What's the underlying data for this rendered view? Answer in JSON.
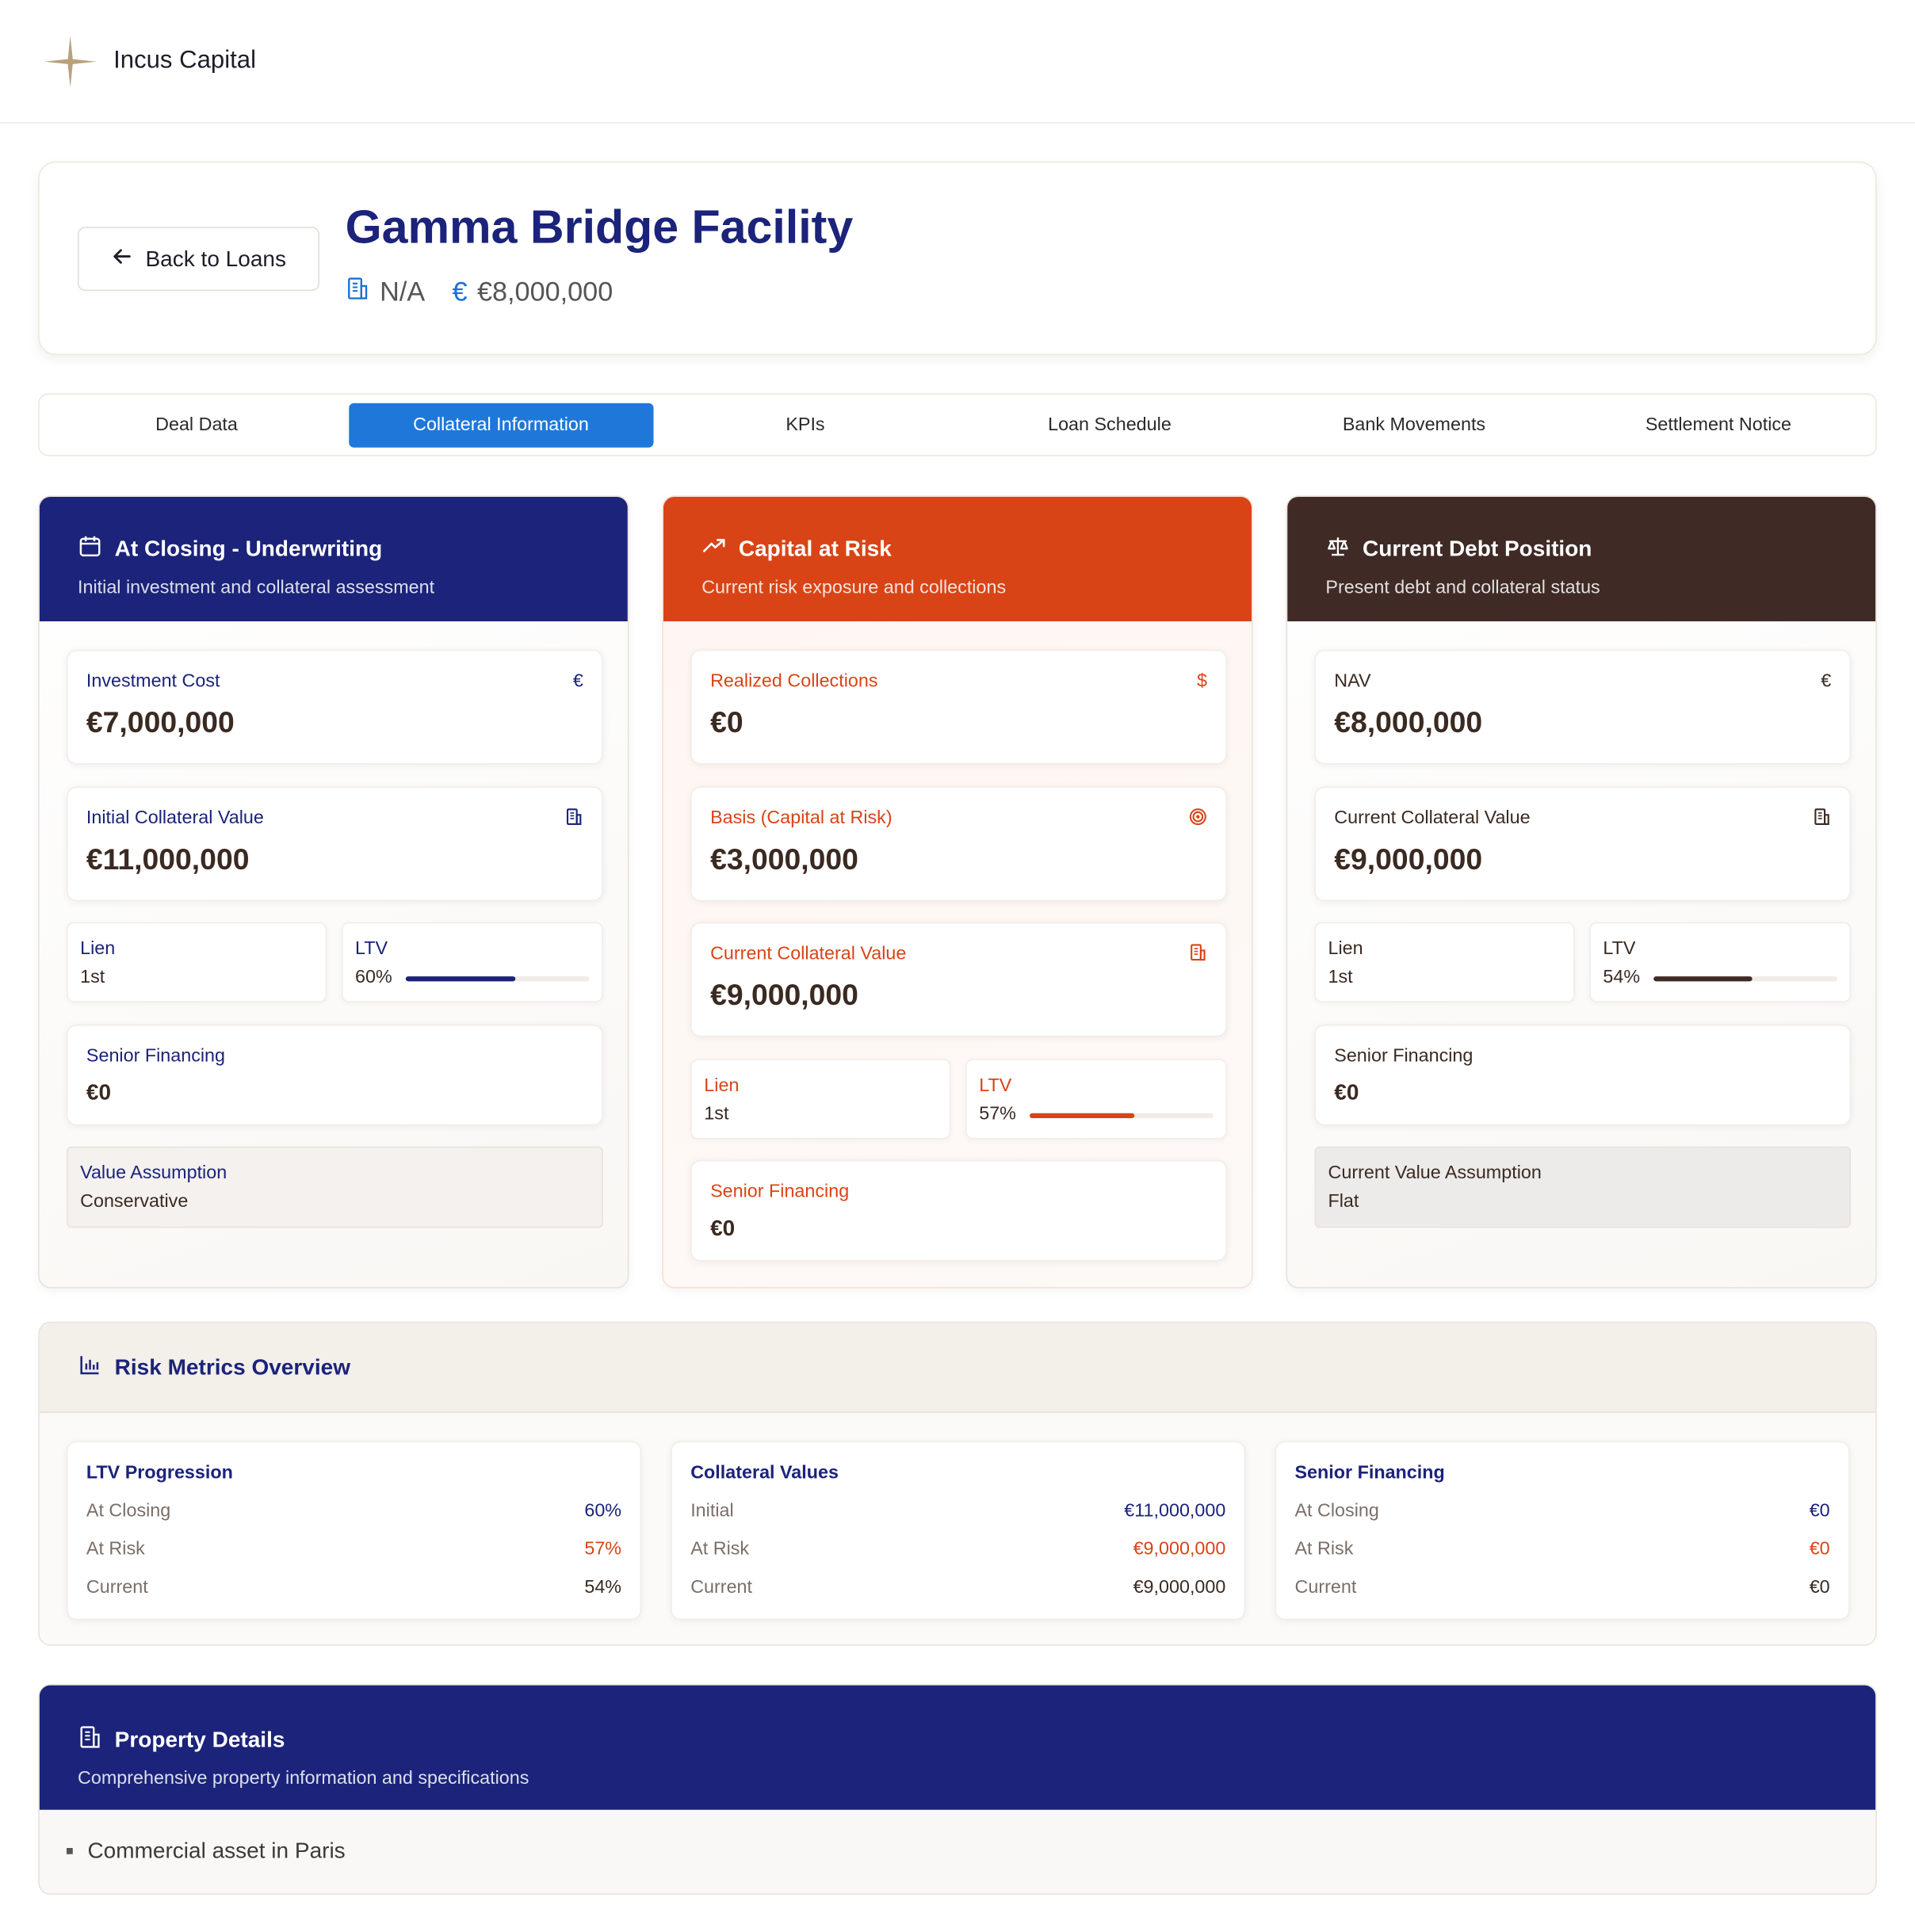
{
  "brand": {
    "name": "Incus Capital",
    "logo_icon": "sparkle-star-icon",
    "logo_color": "#b8a27a"
  },
  "header": {
    "back_label": "Back to Loans",
    "title": "Gamma Bridge Facility",
    "sponsor": "N/A",
    "amount": "€8,000,000",
    "euro_symbol": "€"
  },
  "tabs": [
    {
      "label": "Deal Data",
      "active": false
    },
    {
      "label": "Collateral Information",
      "active": true
    },
    {
      "label": "KPIs",
      "active": false
    },
    {
      "label": "Loan Schedule",
      "active": false
    },
    {
      "label": "Bank Movements",
      "active": false
    },
    {
      "label": "Settlement Notice",
      "active": false
    }
  ],
  "closing": {
    "title": "At Closing - Underwriting",
    "subtitle": "Initial investment and collateral assessment",
    "investment_cost_label": "Investment Cost",
    "investment_cost_value": "€7,000,000",
    "collateral_label": "Initial Collateral Value",
    "collateral_value": "€11,000,000",
    "lien_label": "Lien",
    "lien_value": "1st",
    "ltv_label": "LTV",
    "ltv_value": "60%",
    "ltv_fraction": 0.6,
    "senior_label": "Senior Financing",
    "senior_value": "€0",
    "assumption_label": "Value Assumption",
    "assumption_value": "Conservative",
    "euro_symbol": "€"
  },
  "risk_col": {
    "title": "Capital at Risk",
    "subtitle": "Current risk exposure and collections",
    "collections_label": "Realized Collections",
    "collections_value": "€0",
    "basis_label": "Basis (Capital at Risk)",
    "basis_value": "€3,000,000",
    "collateral_label": "Current Collateral Value",
    "collateral_value": "€9,000,000",
    "lien_label": "Lien",
    "lien_value": "1st",
    "ltv_label": "LTV",
    "ltv_value": "57%",
    "ltv_fraction": 0.57,
    "senior_label": "Senior Financing",
    "senior_value": "€0",
    "dollar_symbol": "$"
  },
  "debt": {
    "title": "Current Debt Position",
    "subtitle": "Present debt and collateral status",
    "nav_label": "NAV",
    "nav_value": "€8,000,000",
    "collateral_label": "Current Collateral Value",
    "collateral_value": "€9,000,000",
    "lien_label": "Lien",
    "lien_value": "1st",
    "ltv_label": "LTV",
    "ltv_value": "54%",
    "ltv_fraction": 0.54,
    "senior_label": "Senior Financing",
    "senior_value": "€0",
    "assumption_label": "Current Value Assumption",
    "assumption_value": "Flat",
    "euro_symbol": "€"
  },
  "metrics": {
    "title": "Risk Metrics Overview",
    "ltv": {
      "title": "LTV Progression",
      "rows": [
        [
          "At Closing",
          "60%"
        ],
        [
          "At Risk",
          "57%"
        ],
        [
          "Current",
          "54%"
        ]
      ]
    },
    "collateral": {
      "title": "Collateral Values",
      "rows": [
        [
          "Initial",
          "€11,000,000"
        ],
        [
          "At Risk",
          "€9,000,000"
        ],
        [
          "Current",
          "€9,000,000"
        ]
      ]
    },
    "senior": {
      "title": "Senior Financing",
      "rows": [
        [
          "At Closing",
          "€0"
        ],
        [
          "At Risk",
          "€0"
        ],
        [
          "Current",
          "€0"
        ]
      ]
    }
  },
  "property": {
    "title": "Property Details",
    "subtitle": "Comprehensive property information and specifications",
    "items": [
      "Commercial asset in Paris"
    ]
  },
  "colors": {
    "navy": "#1b237a",
    "orange": "#d94416",
    "brown": "#3f2a26",
    "tab_active": "#1f78d9"
  }
}
